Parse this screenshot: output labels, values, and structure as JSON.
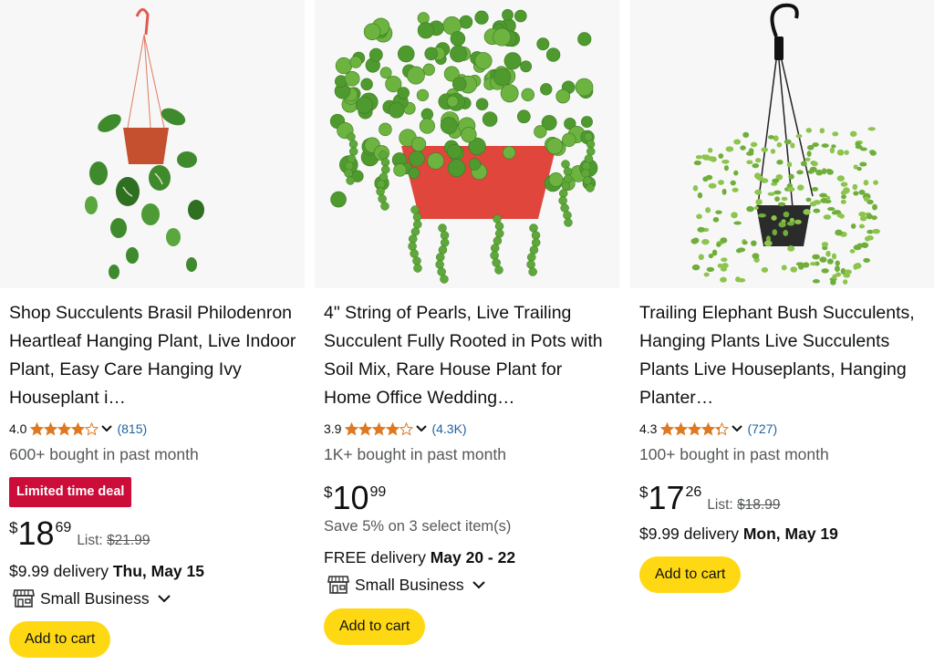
{
  "accent_colors": {
    "button": "#ffd814",
    "deal_badge": "#cc0c39",
    "star": "#de7921",
    "link": "#2162a1"
  },
  "products": [
    {
      "image_icon": "pothos-hanging-plant-image",
      "title": "Shop Succulents Brasil Philodenron Heartleaf Hanging Plant, Live Indoor Plant, Easy Care Hanging Ivy Houseplant i…",
      "rating": "4.0",
      "stars": 4.0,
      "reviews": "(815)",
      "bought": "600+ bought in past month",
      "deal_badge": "Limited time deal",
      "price_symbol": "$",
      "price_whole": "18",
      "price_fraction": "69",
      "list_label": "List:",
      "list_price": "$21.99",
      "delivery_prefix": "$9.99 delivery ",
      "delivery_date": "Thu, May 15",
      "small_business": "Small Business",
      "add_to_cart": "Add to cart"
    },
    {
      "image_icon": "string-of-pearls-plant-image",
      "title": "4\" String of Pearls, Live Trailing Succulent Fully Rooted in Pots with Soil Mix, Rare House Plant for Home Office Wedding…",
      "rating": "3.9",
      "stars": 3.9,
      "reviews": "(4.3K)",
      "bought": "1K+ bought in past month",
      "price_symbol": "$",
      "price_whole": "10",
      "price_fraction": "99",
      "save_text": "Save 5% on 3 select item(s)",
      "delivery_prefix": "FREE delivery ",
      "delivery_date": "May 20 - 22",
      "small_business": "Small Business",
      "add_to_cart": "Add to cart"
    },
    {
      "image_icon": "elephant-bush-hanging-plant-image",
      "title": "Trailing Elephant Bush Succulents, Hanging Plants Live Succulents Plants Live Houseplants, Hanging Planter…",
      "rating": "4.3",
      "stars": 4.3,
      "reviews": "(727)",
      "bought": "100+ bought in past month",
      "price_symbol": "$",
      "price_whole": "17",
      "price_fraction": "26",
      "list_label": "List:",
      "list_price": "$18.99",
      "delivery_prefix": "$9.99 delivery ",
      "delivery_date": "Mon, May 19",
      "add_to_cart": "Add to cart"
    }
  ]
}
